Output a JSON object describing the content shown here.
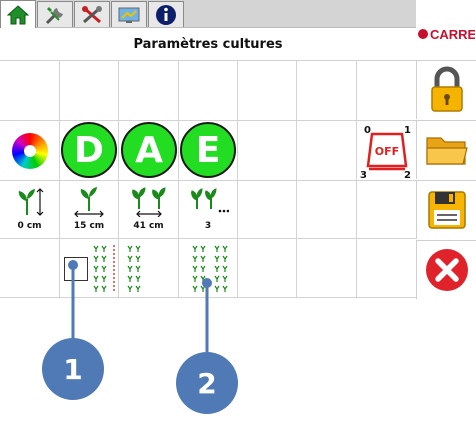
{
  "window": {
    "title": "Paramètres cultures"
  },
  "tabs": [
    {
      "name": "home"
    },
    {
      "name": "tools"
    },
    {
      "name": "settings"
    },
    {
      "name": "display"
    },
    {
      "name": "info"
    }
  ],
  "brand": {
    "logo_text": "CARRE",
    "accent": "#c8102e"
  },
  "colors": {
    "green": "#22dd22",
    "red_off": "#e02020",
    "callout": "#4f7ab5"
  },
  "modes": [
    {
      "letter": "D"
    },
    {
      "letter": "A"
    },
    {
      "letter": "E"
    }
  ],
  "measures": [
    {
      "icon": "plant-height-icon",
      "value": "0 cm"
    },
    {
      "icon": "plant-width-icon",
      "value": "15 cm"
    },
    {
      "icon": "row-spacing-icon",
      "value": "41 cm"
    },
    {
      "icon": "row-count-icon",
      "value": "3"
    }
  ],
  "off_widget": {
    "label": "OFF",
    "corners": [
      "0",
      "1",
      "2",
      "3"
    ]
  },
  "callouts": [
    {
      "number": "1"
    },
    {
      "number": "2"
    }
  ],
  "sidebar": [
    {
      "name": "lock-icon"
    },
    {
      "name": "folder-icon"
    },
    {
      "name": "save-icon"
    },
    {
      "name": "close-icon"
    }
  ]
}
